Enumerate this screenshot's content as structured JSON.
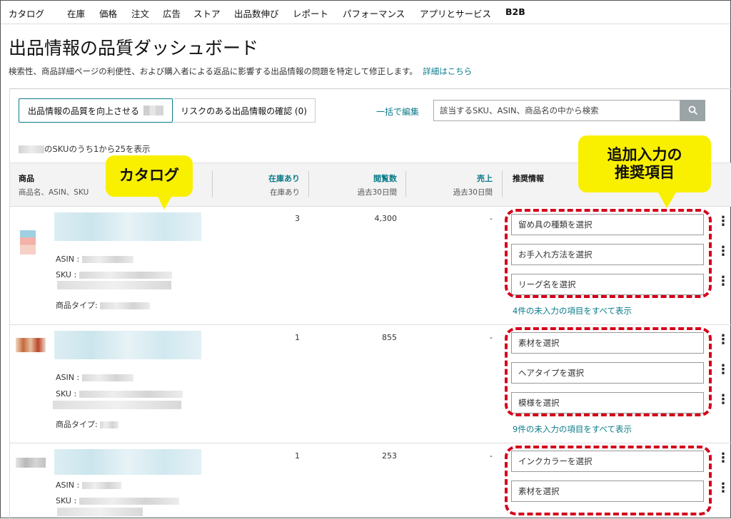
{
  "nav": [
    "カタログ",
    "在庫",
    "価格",
    "注文",
    "広告",
    "ストア",
    "出品数伸び",
    "レポート",
    "パフォーマンス",
    "アプリとサービス",
    "B2B"
  ],
  "page": {
    "title": "出品情報の品質ダッシュボード",
    "subtitle": "検索性、商品詳細ページの利便性、および購入者による返品に影響する出品情報の問題を特定して修正します。",
    "learn_more": "詳細はこちら"
  },
  "toolbar": {
    "improve_tab": "出品情報の品質を向上させる",
    "risk_tab": "リスクのある出品情報の確認 (0)",
    "bulk_edit": "一括で編集",
    "search_placeholder": "該当するSKU、ASIN、商品名の中から検索",
    "search_icon": "search-icon",
    "count_text": "のSKUのうち1から25を表示"
  },
  "table_header": {
    "product": "商品",
    "product_sub": "商品名、ASIN、SKU",
    "in_stock": "在庫あり",
    "in_stock_sub": "在庫あり",
    "views": "閲覧数",
    "views_sub": "過去30日間",
    "sales": "売上",
    "sales_sub": "過去30日間",
    "recommendations": "推奨情報"
  },
  "rows": [
    {
      "asin_label": "ASIN :",
      "sku_label": "SKU :",
      "type_label": "商品タイプ:",
      "stock": "3",
      "views": "4,300",
      "sales": "-",
      "recs": [
        "留め具の種類を選択",
        "お手入れ方法を選択",
        "リーグ名を選択"
      ],
      "show_all": "4件の未入力の項目をすべて表示"
    },
    {
      "asin_label": "ASIN :",
      "sku_label": "SKU :",
      "type_label": "商品タイプ:",
      "stock": "1",
      "views": "855",
      "sales": "-",
      "recs": [
        "素材を選択",
        "ヘアタイプを選択",
        "模様を選択"
      ],
      "show_all": "9件の未入力の項目をすべて表示"
    },
    {
      "asin_label": "ASIN :",
      "sku_label": "SKU :",
      "stock": "1",
      "views": "253",
      "sales": "-",
      "recs": [
        "インクカラーを選択",
        "素材を選択"
      ]
    }
  ],
  "callouts": {
    "catalog": "カタログ",
    "recommend_line1": "追加入力の",
    "recommend_line2": "推奨項目"
  },
  "colors": {
    "link": "#0a7b8a",
    "callout": "#f9f000",
    "highlight": "#d4001a"
  }
}
